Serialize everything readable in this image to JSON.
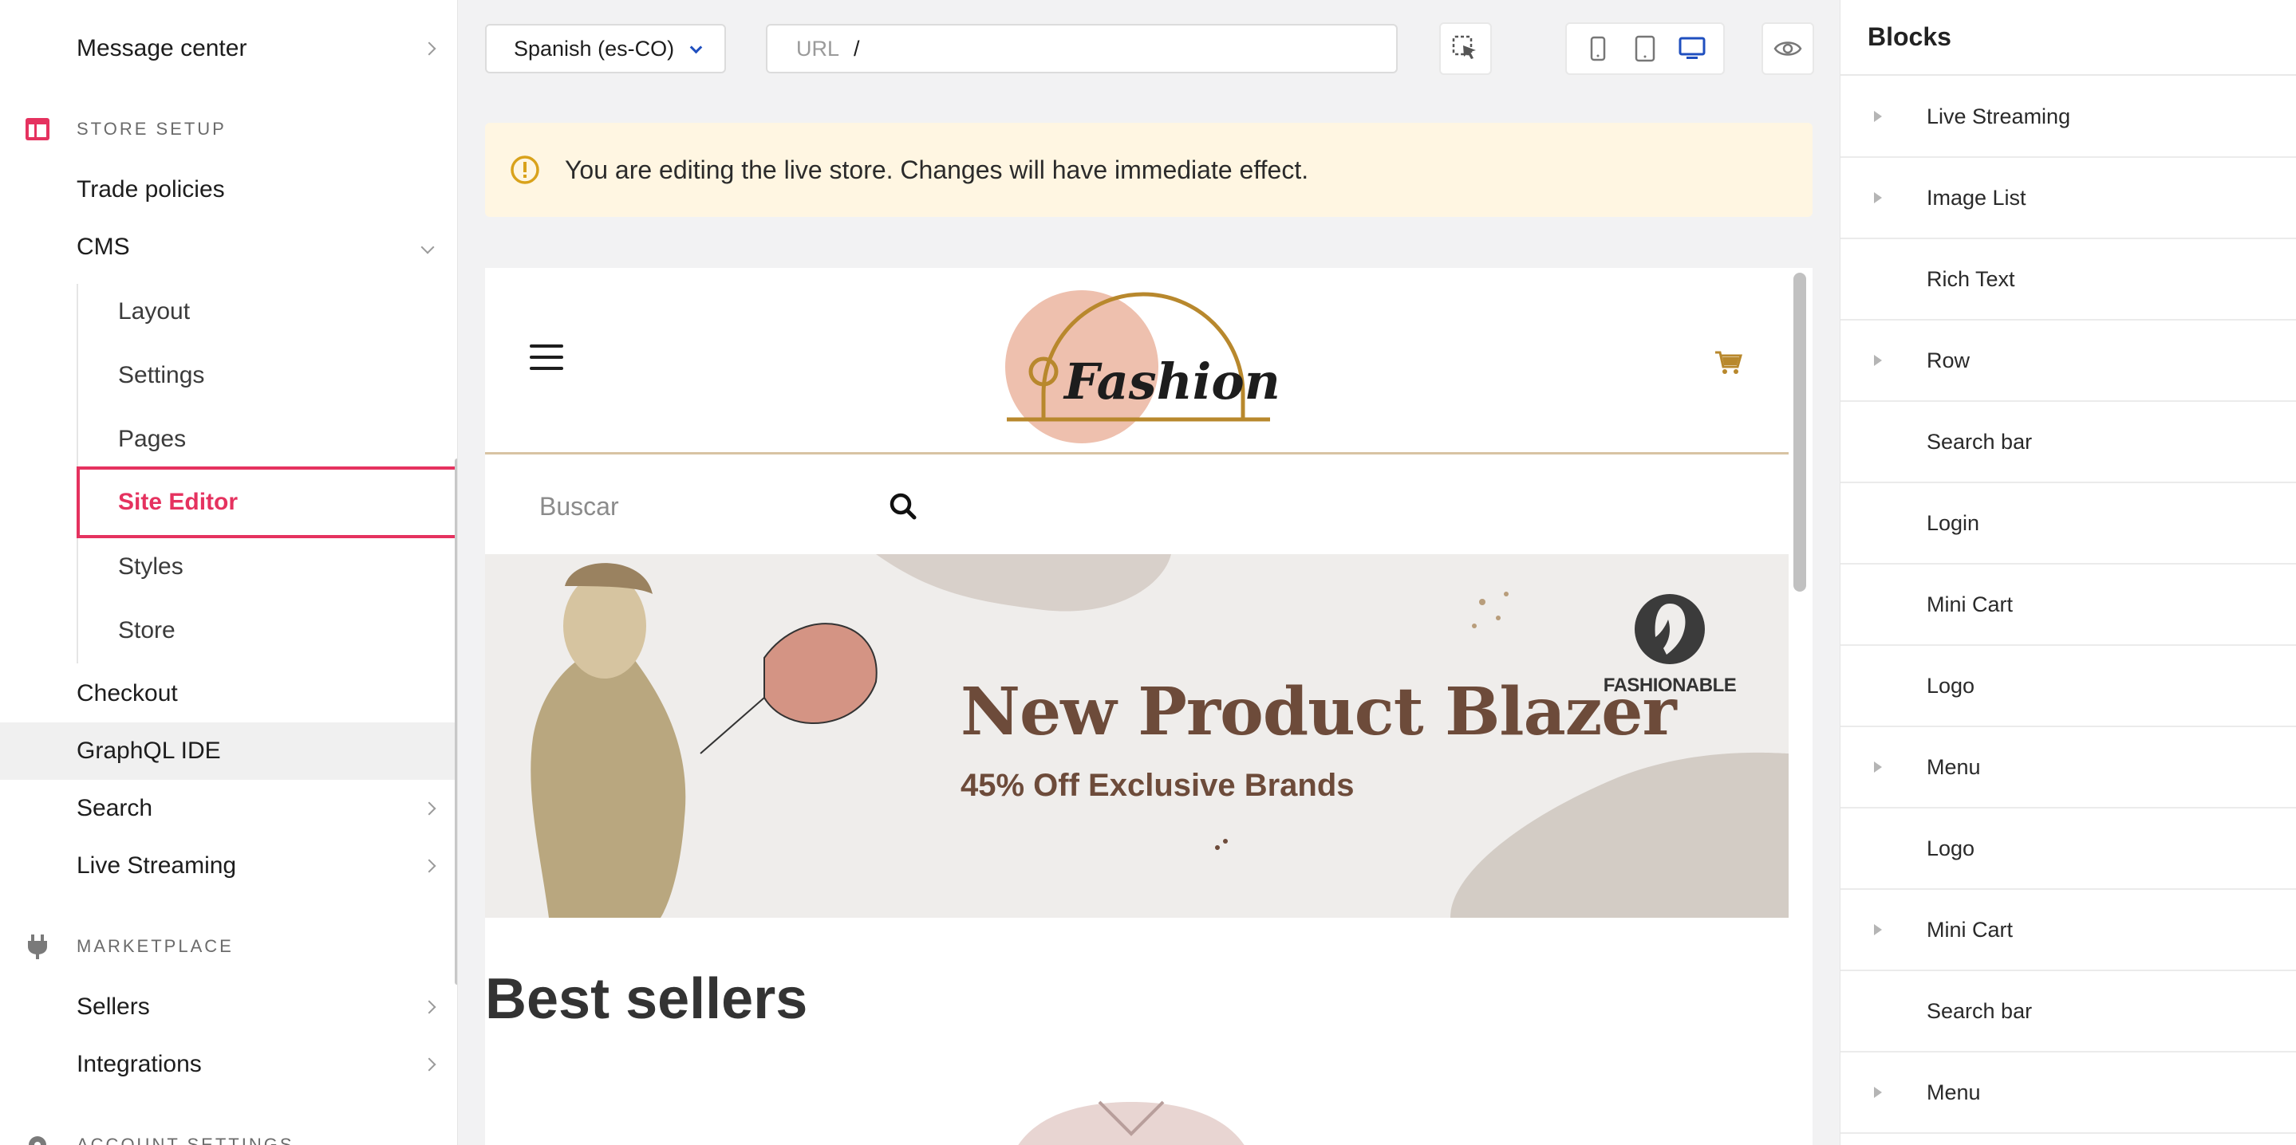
{
  "sidebar": {
    "top_item": "Message center",
    "store_setup_label": "STORE SETUP",
    "trade_policies": "Trade policies",
    "cms": "CMS",
    "cms_sub": [
      "Layout",
      "Settings",
      "Pages",
      "Site Editor",
      "Styles",
      "Store"
    ],
    "checkout": "Checkout",
    "graphql": "GraphQL IDE",
    "search": "Search",
    "live_streaming": "Live Streaming",
    "marketplace_label": "MARKETPLACE",
    "sellers": "Sellers",
    "integrations": "Integrations",
    "account_settings_label": "ACCOUNT SETTINGS",
    "accent_color": "#e5325f"
  },
  "toolbar": {
    "locale": "Spanish (es-CO)",
    "url_label": "URL",
    "url_value": "/"
  },
  "notice": {
    "text": "You are editing the live store. Changes will have immediate effect.",
    "bg_color": "#fff6e2"
  },
  "preview": {
    "logo_text": "Fashion",
    "search_placeholder": "Buscar",
    "banner_title": "New Product Blazer",
    "banner_subtitle": "45% Off Exclusive Brands",
    "brand": "FASHIONABLE",
    "section_title": "Best sellers"
  },
  "blocks": {
    "title": "Blocks",
    "items": [
      {
        "label": "Live Streaming",
        "expandable": true
      },
      {
        "label": "Image List",
        "expandable": true
      },
      {
        "label": "Rich Text",
        "expandable": false
      },
      {
        "label": "Row",
        "expandable": true
      },
      {
        "label": "Search bar",
        "expandable": false
      },
      {
        "label": "Login",
        "expandable": false
      },
      {
        "label": "Mini Cart",
        "expandable": false
      },
      {
        "label": "Logo",
        "expandable": false
      },
      {
        "label": "Menu",
        "expandable": true
      },
      {
        "label": "Logo",
        "expandable": false
      },
      {
        "label": "Mini Cart",
        "expandable": true
      },
      {
        "label": "Search bar",
        "expandable": false
      },
      {
        "label": "Menu",
        "expandable": true
      }
    ]
  }
}
